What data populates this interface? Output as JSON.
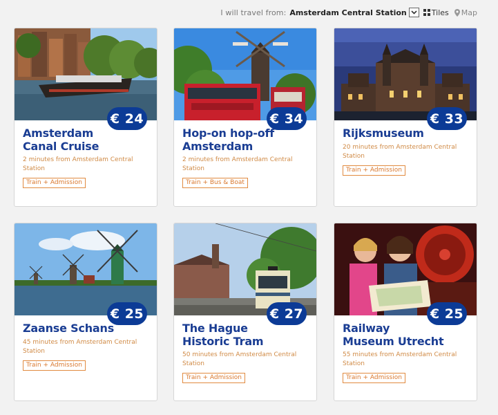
{
  "header": {
    "travel_label": "I will travel from:",
    "station": "Amsterdam Central Station",
    "tiles_label": "Tiles",
    "map_label": "Map"
  },
  "cards": [
    {
      "title_line1": "Amsterdam",
      "title_line2": "Canal Cruise",
      "price": "€ 24",
      "distance": "2 minutes from Amsterdam Central Station",
      "tag": "Train + Admission"
    },
    {
      "title_line1": "Hop-on hop-off",
      "title_line2": "Amsterdam",
      "price": "€ 34",
      "distance": "2 minutes from Amsterdam Central Station",
      "tag": "Train + Bus & Boat"
    },
    {
      "title_line1": "Rijksmuseum",
      "title_line2": "",
      "price": "€ 33",
      "distance": "20 minutes from Amsterdam Central Station",
      "tag": "Train + Admission"
    },
    {
      "title_line1": "Zaanse Schans",
      "title_line2": "",
      "price": "€ 25",
      "distance": "45 minutes from Amsterdam Central Station",
      "tag": "Train + Admission"
    },
    {
      "title_line1": "The Hague",
      "title_line2": "Historic Tram",
      "price": "€ 27",
      "distance": "50 minutes from Amsterdam Central Station",
      "tag": "Train + Admission"
    },
    {
      "title_line1": "Railway",
      "title_line2": "Museum Utrecht",
      "price": "€ 25",
      "distance": "55 minutes from Amsterdam Central Station",
      "tag": "Train + Admission"
    }
  ]
}
